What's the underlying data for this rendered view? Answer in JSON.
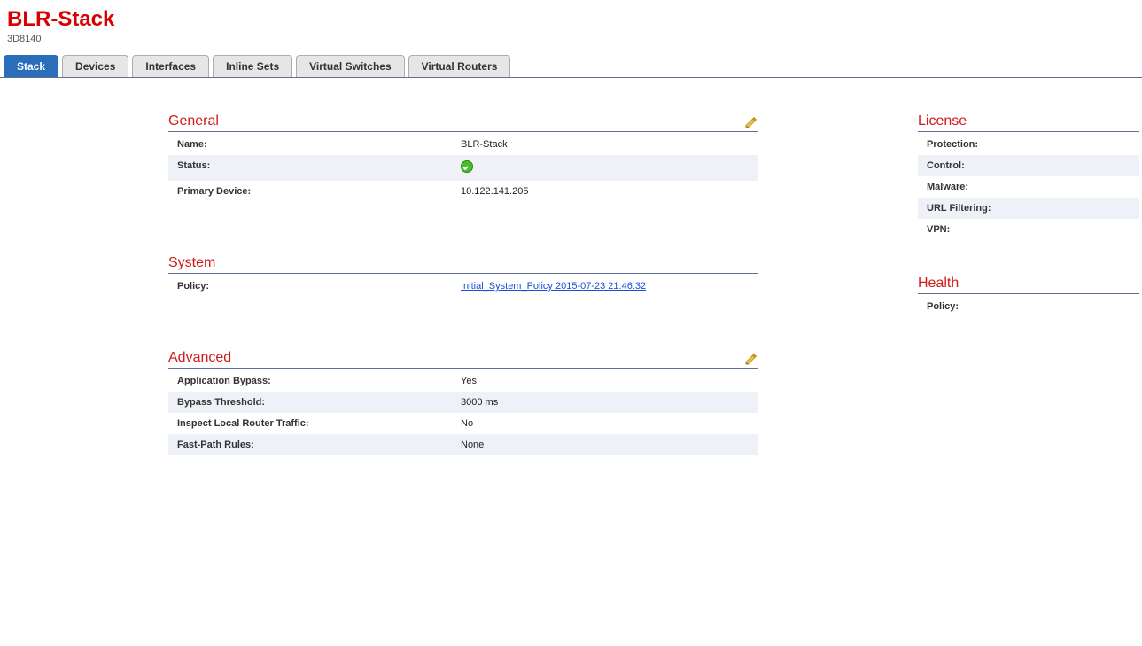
{
  "header": {
    "title": "BLR-Stack",
    "subtitle": "3D8140"
  },
  "tabs": [
    {
      "label": "Stack",
      "active": true
    },
    {
      "label": "Devices",
      "active": false
    },
    {
      "label": "Interfaces",
      "active": false
    },
    {
      "label": "Inline Sets",
      "active": false
    },
    {
      "label": "Virtual Switches",
      "active": false
    },
    {
      "label": "Virtual Routers",
      "active": false
    }
  ],
  "sections": {
    "general": {
      "title": "General",
      "rows": [
        {
          "k": "Name:",
          "v": "BLR-Stack",
          "type": "text"
        },
        {
          "k": "Status:",
          "v": "ok",
          "type": "status"
        },
        {
          "k": "Primary Device:",
          "v": "10.122.141.205",
          "type": "text"
        }
      ],
      "editable": true
    },
    "system": {
      "title": "System",
      "rows": [
        {
          "k": "Policy:",
          "v": "Initial_System_Policy 2015-07-23 21:46:32",
          "type": "link"
        }
      ],
      "editable": false
    },
    "advanced": {
      "title": "Advanced",
      "rows": [
        {
          "k": "Application Bypass:",
          "v": "Yes",
          "type": "text"
        },
        {
          "k": "Bypass Threshold:",
          "v": "3000 ms",
          "type": "text"
        },
        {
          "k": "Inspect Local Router Traffic:",
          "v": "No",
          "type": "text"
        },
        {
          "k": "Fast-Path Rules:",
          "v": "None",
          "type": "text"
        }
      ],
      "editable": true
    }
  },
  "sidebar": {
    "license": {
      "title": "License",
      "rows": [
        "Protection:",
        "Control:",
        "Malware:",
        "URL Filtering:",
        "VPN:"
      ]
    },
    "health": {
      "title": "Health",
      "rows": [
        "Policy:"
      ]
    }
  }
}
